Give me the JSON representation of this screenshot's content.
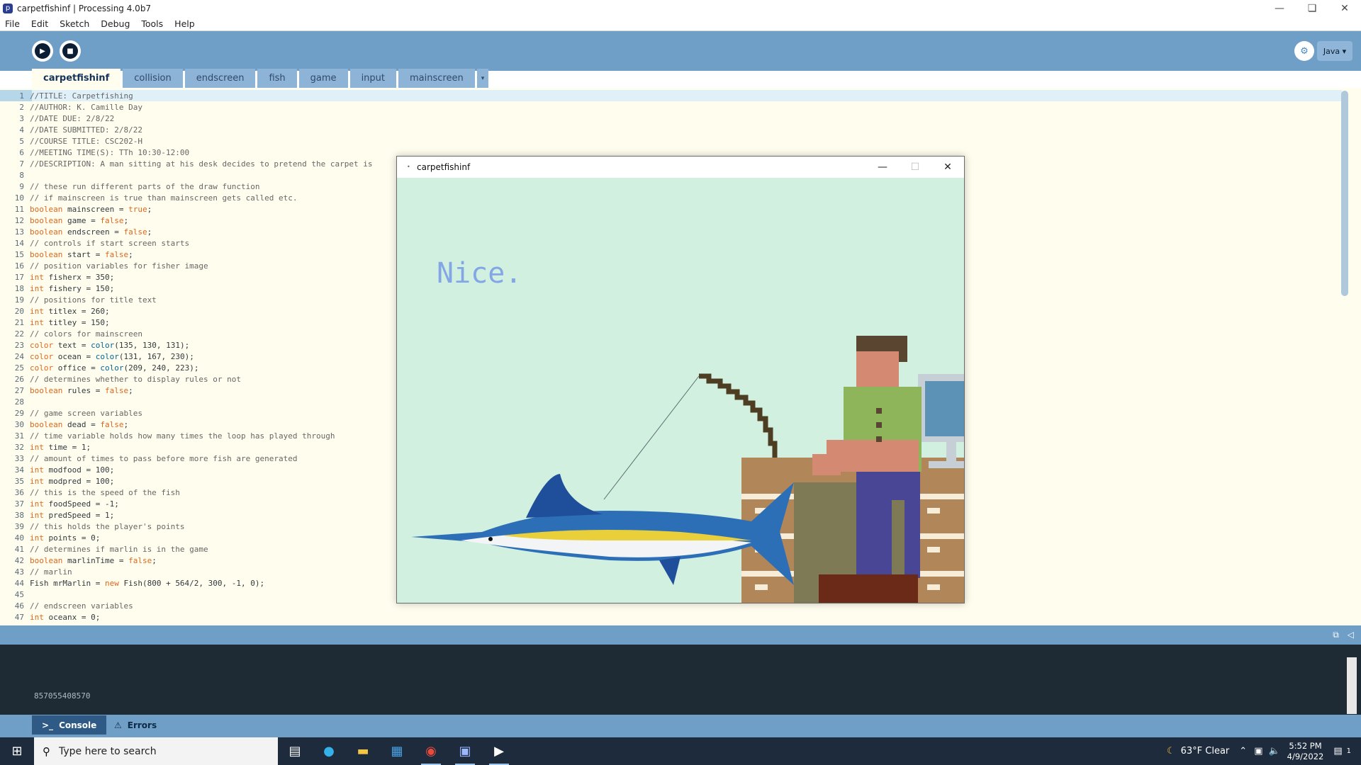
{
  "window": {
    "title": "carpetfishinf | Processing 4.0b7",
    "app_icon": "processing-icon"
  },
  "menu": [
    "File",
    "Edit",
    "Sketch",
    "Debug",
    "Tools",
    "Help"
  ],
  "toolbar": {
    "run_icon": "play-icon",
    "stop_icon": "stop-icon",
    "debug_icon": "debugger-icon",
    "mode_label": "Java ▾"
  },
  "tabs": [
    "carpetfishinf",
    "collision",
    "endscreen",
    "fish",
    "game",
    "input",
    "mainscreen"
  ],
  "tabs_more": "▾",
  "code": [
    {
      "n": "1",
      "t": "//TITLE: Carpetfishing",
      "c": true
    },
    {
      "n": "2",
      "t": "//AUTHOR: K. Camille Day",
      "c": true
    },
    {
      "n": "3",
      "t": "//DATE DUE: 2/8/22",
      "c": true
    },
    {
      "n": "4",
      "t": "//DATE SUBMITTED: 2/8/22",
      "c": true
    },
    {
      "n": "5",
      "t": "//COURSE TITLE: CSC202-H",
      "c": true
    },
    {
      "n": "6",
      "t": "//MEETING TIME(S): TTh 10:30-12:00",
      "c": true
    },
    {
      "n": "7",
      "t": "//DESCRIPTION: A man sitting at his desk decides to pretend the carpet is",
      "c": true
    },
    {
      "n": "8",
      "t": ""
    },
    {
      "n": "9",
      "t": "// these run different parts of the draw function",
      "c": true
    },
    {
      "n": "10",
      "t": "// if mainscreen is true than mainscreen gets called etc.",
      "c": true
    },
    {
      "n": "11",
      "k": "boolean",
      "t": " mainscreen = ",
      "v": "true",
      "e": ";"
    },
    {
      "n": "12",
      "k": "boolean",
      "t": " game = ",
      "v": "false",
      "e": ";"
    },
    {
      "n": "13",
      "k": "boolean",
      "t": " endscreen = ",
      "v": "false",
      "e": ";"
    },
    {
      "n": "14",
      "t": "// controls if start screen starts",
      "c": true
    },
    {
      "n": "15",
      "k": "boolean",
      "t": " start = ",
      "v": "false",
      "e": ";"
    },
    {
      "n": "16",
      "t": "// position variables for fisher image",
      "c": true
    },
    {
      "n": "17",
      "k": "int",
      "t": " fisherx = 350;"
    },
    {
      "n": "18",
      "k": "int",
      "t": " fishery = 150;"
    },
    {
      "n": "19",
      "t": "// positions for title text",
      "c": true
    },
    {
      "n": "20",
      "k": "int",
      "t": " titlex = 260;"
    },
    {
      "n": "21",
      "k": "int",
      "t": " titley = 150;"
    },
    {
      "n": "22",
      "t": "// colors for mainscreen",
      "c": true
    },
    {
      "n": "23",
      "k": "color",
      "t": " text = ",
      "f": "color",
      "e": "(135, 130, 131);"
    },
    {
      "n": "24",
      "k": "color",
      "t": " ocean = ",
      "f": "color",
      "e": "(131, 167, 230);"
    },
    {
      "n": "25",
      "k": "color",
      "t": " office = ",
      "f": "color",
      "e": "(209, 240, 223);"
    },
    {
      "n": "26",
      "t": "// determines whether to display rules or not",
      "c": true
    },
    {
      "n": "27",
      "k": "boolean",
      "t": " rules = ",
      "v": "false",
      "e": ";"
    },
    {
      "n": "28",
      "t": ""
    },
    {
      "n": "29",
      "t": "// game screen variables",
      "c": true
    },
    {
      "n": "30",
      "k": "boolean",
      "t": " dead = ",
      "v": "false",
      "e": ";"
    },
    {
      "n": "31",
      "t": "// time variable holds how many times the loop has played through",
      "c": true
    },
    {
      "n": "32",
      "k": "int",
      "t": " time = 1;"
    },
    {
      "n": "33",
      "t": "// amount of times to pass before more fish are generated",
      "c": true
    },
    {
      "n": "34",
      "k": "int",
      "t": " modfood = 100;"
    },
    {
      "n": "35",
      "k": "int",
      "t": " modpred = 100;"
    },
    {
      "n": "36",
      "t": "// this is the speed of the fish",
      "c": true
    },
    {
      "n": "37",
      "k": "int",
      "t": " foodSpeed = -1;"
    },
    {
      "n": "38",
      "k": "int",
      "t": " predSpeed = 1;"
    },
    {
      "n": "39",
      "t": "// this holds the player's points",
      "c": true
    },
    {
      "n": "40",
      "k": "int",
      "t": " points = 0;"
    },
    {
      "n": "41",
      "t": "// determines if marlin is in the game",
      "c": true
    },
    {
      "n": "42",
      "k": "boolean",
      "t": " marlinTime = ",
      "v": "false",
      "e": ";"
    },
    {
      "n": "43",
      "t": "// marlin",
      "c": true
    },
    {
      "n": "44",
      "t": "Fish mrMarlin = ",
      "v": "new",
      "e": " Fish(800 + 564/2, 300, -1, 0);"
    },
    {
      "n": "45",
      "t": ""
    },
    {
      "n": "46",
      "t": "// endscreen variables",
      "c": true
    },
    {
      "n": "47",
      "k": "int",
      "t": " oceanx = 0;"
    }
  ],
  "console": {
    "output": "857055408570",
    "tabs": [
      "Console",
      "Errors"
    ]
  },
  "sketch": {
    "title": "carpetfishinf",
    "text": "Nice.",
    "colors": {
      "office": "#d1f0df",
      "text": "#83a7e6"
    }
  },
  "taskbar": {
    "search_placeholder": "Type here to search",
    "weather": "63°F  Clear",
    "time": "5:52 PM",
    "date": "4/9/2022",
    "notifications": "1"
  },
  "colors": {
    "toolbar": "#6f9ec7",
    "editor_bg": "#fffdee",
    "keyword": "#e2661a",
    "console_bg": "#1e2b34"
  }
}
